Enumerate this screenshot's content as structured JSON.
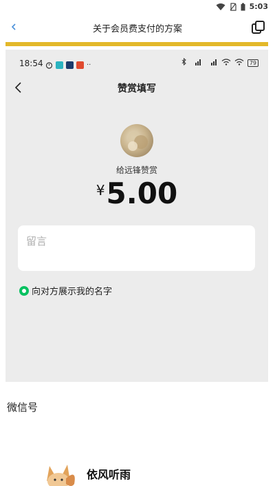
{
  "status_bar": {
    "time": "5:03"
  },
  "header": {
    "title": "关于会员费支付的方案",
    "back_icon": "‹"
  },
  "embedded_screenshot": {
    "status": {
      "time": "18:54",
      "battery": "79"
    },
    "nav_title": "赞赏填写",
    "recipient_line": "给远锋赞赏",
    "amount": {
      "currency": "¥",
      "value": "5.00"
    },
    "message_placeholder": "留言",
    "show_name_label": "向对方展示我的名字",
    "show_name_checked": true
  },
  "section": {
    "label": "微信号",
    "profile_name": "依风听雨"
  },
  "colors": {
    "accent_gold": "#e3b82a",
    "wechat_green": "#07c160",
    "link_blue": "#4a90d9"
  }
}
